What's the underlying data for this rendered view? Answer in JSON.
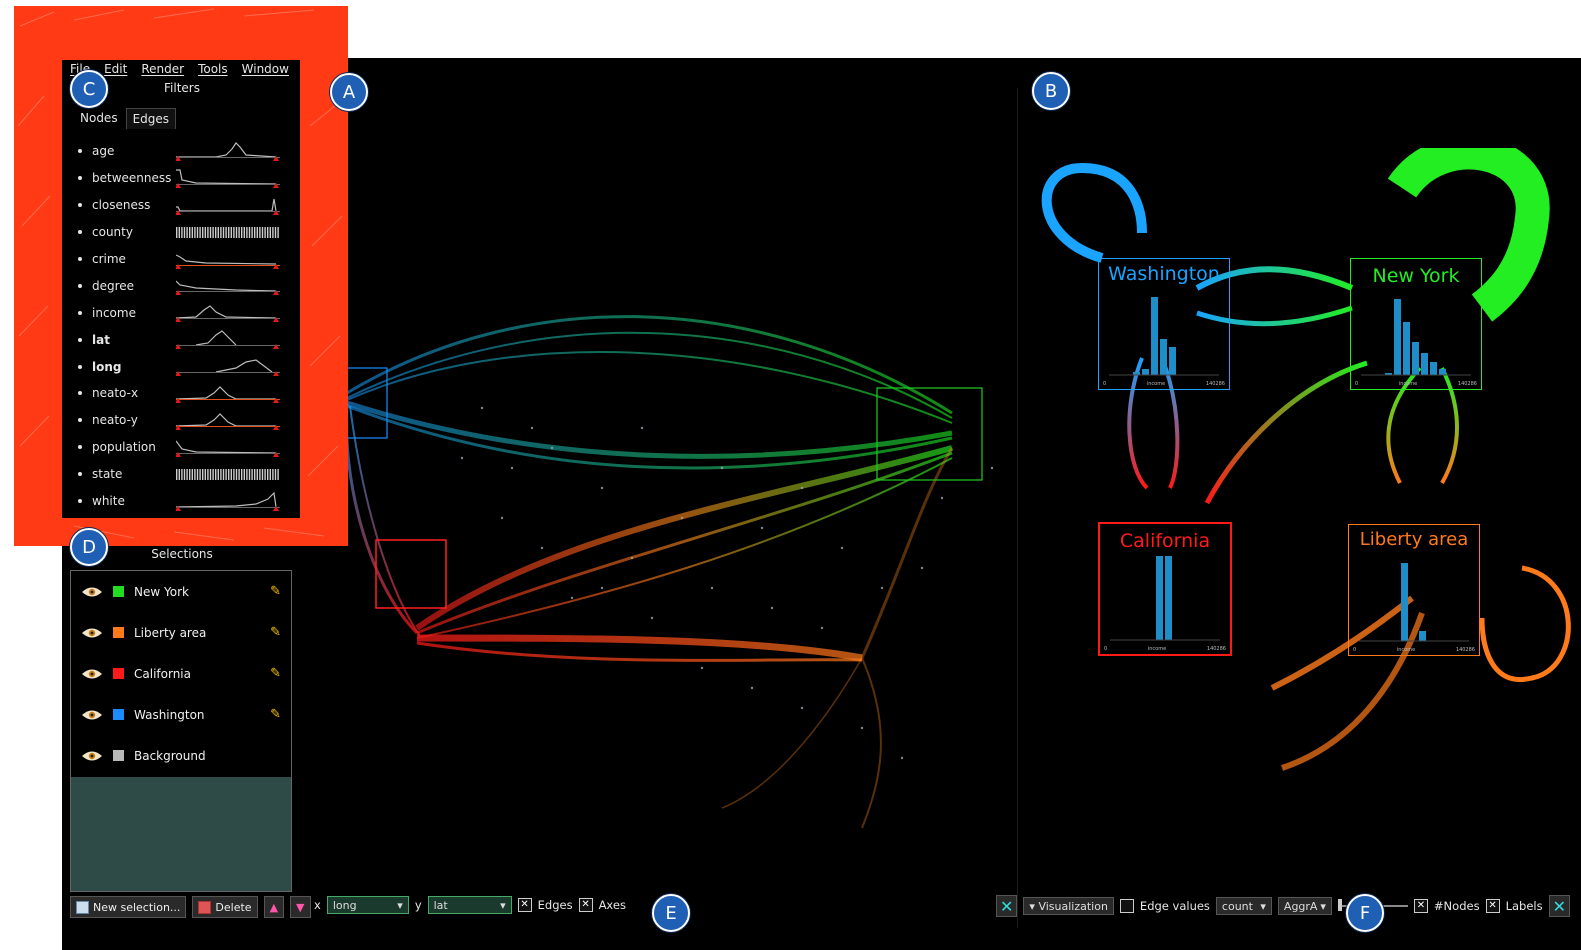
{
  "menu": [
    "File",
    "Edit",
    "Render",
    "Tools",
    "Window"
  ],
  "filters": {
    "title": "Filters",
    "tabs": [
      "Nodes",
      "Edges"
    ],
    "items": [
      {
        "name": "age",
        "bold": false
      },
      {
        "name": "betweenness",
        "bold": false
      },
      {
        "name": "closeness",
        "bold": false
      },
      {
        "name": "county",
        "bold": false
      },
      {
        "name": "crime",
        "bold": false
      },
      {
        "name": "degree",
        "bold": false
      },
      {
        "name": "income",
        "bold": false
      },
      {
        "name": "lat",
        "bold": true
      },
      {
        "name": "long",
        "bold": true
      },
      {
        "name": "neato-x",
        "bold": false
      },
      {
        "name": "neato-y",
        "bold": false
      },
      {
        "name": "population",
        "bold": false
      },
      {
        "name": "state",
        "bold": false
      },
      {
        "name": "white",
        "bold": false
      }
    ]
  },
  "selections": {
    "title": "Selections",
    "items": [
      {
        "name": "New York",
        "color": "#22dd22",
        "editable": true
      },
      {
        "name": "Liberty area",
        "color": "#ff7a1a",
        "editable": true
      },
      {
        "name": "California",
        "color": "#ff1a1a",
        "editable": true
      },
      {
        "name": "Washington",
        "color": "#1a8cff",
        "editable": true
      },
      {
        "name": "Background",
        "color": "#b8b8b8",
        "editable": false
      }
    ],
    "buttons": {
      "new": "New selection...",
      "delete": "Delete"
    }
  },
  "map_toolbar": {
    "x_label": "x",
    "x_value": "long",
    "y_label": "y",
    "y_value": "lat",
    "edges_label": "Edges",
    "edges_checked": true,
    "axes_label": "Axes",
    "axes_checked": true
  },
  "graph_toolbar": {
    "visualization": "Visualization",
    "edge_values_label": "Edge values",
    "edge_values_checked": false,
    "count_value": "count",
    "aggr_value": "AggrA",
    "nodes_label": "#Nodes",
    "nodes_checked": true,
    "labels_label": "Labels",
    "labels_checked": true
  },
  "graph_nodes": [
    {
      "name": "Washington",
      "color": "#1aa3ff",
      "axis_min": "0",
      "axis_label": "income",
      "axis_max": "140286"
    },
    {
      "name": "New York",
      "color": "#22ee22",
      "axis_min": "0",
      "axis_label": "income",
      "axis_max": "140286"
    },
    {
      "name": "California",
      "color": "#ff1a1a",
      "axis_min": "0",
      "axis_label": "income",
      "axis_max": "140286"
    },
    {
      "name": "Liberty area",
      "color": "#ff7a1a",
      "axis_min": "0",
      "axis_label": "income",
      "axis_max": "140286"
    }
  ],
  "badges": {
    "a": "A",
    "b": "B",
    "c": "C",
    "d": "D",
    "e": "E",
    "f": "F"
  },
  "colors": {
    "highlight": "#ff3a14",
    "badge": "#1f5fb4",
    "panel_fill": "#2e4b47"
  }
}
